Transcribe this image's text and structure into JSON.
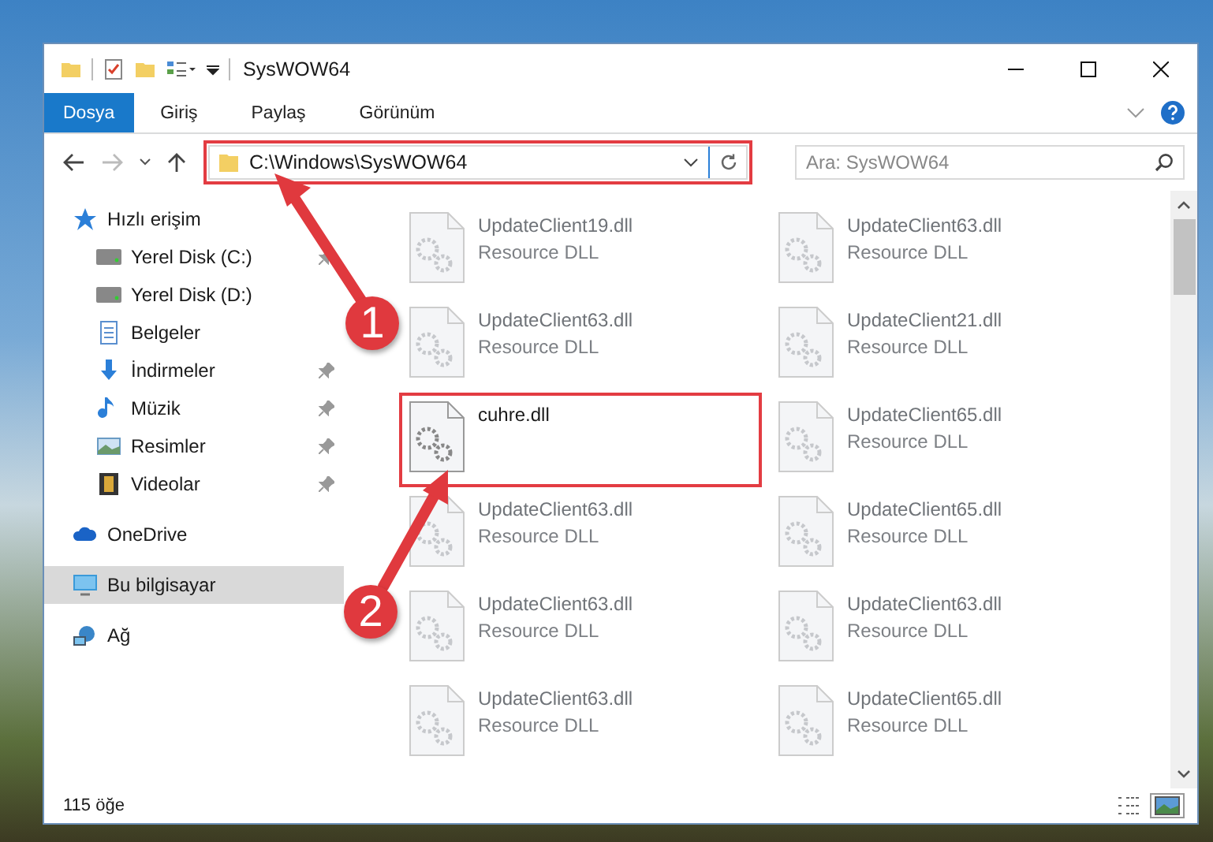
{
  "window": {
    "title": "SysWOW64"
  },
  "ribbon_tabs": [
    {
      "label": "Dosya",
      "kind": "file"
    },
    {
      "label": "Giriş",
      "kind": "tab"
    },
    {
      "label": "Paylaş",
      "kind": "tab"
    },
    {
      "label": "Görünüm",
      "kind": "tab"
    }
  ],
  "address_bar": {
    "path": "C:\\Windows\\SysWOW64",
    "highlighted": true
  },
  "search": {
    "placeholder": "Ara: SysWOW64"
  },
  "navigation": [
    {
      "label": "Hızlı erişim",
      "kind": "star",
      "selected": false,
      "children": [
        {
          "label": "Yerel Disk (C:)",
          "kind": "drive",
          "pinned": true,
          "selected": false
        },
        {
          "label": "Yerel Disk (D:)",
          "kind": "drive",
          "pinned": false,
          "selected": false
        },
        {
          "label": "Belgeler",
          "kind": "docs",
          "pinned": false,
          "selected": false
        },
        {
          "label": "İndirmeler",
          "kind": "download",
          "pinned": true,
          "selected": false
        },
        {
          "label": "Müzik",
          "kind": "music",
          "pinned": true,
          "selected": false
        },
        {
          "label": "Resimler",
          "kind": "pictures",
          "pinned": true,
          "selected": false
        },
        {
          "label": "Videolar",
          "kind": "video",
          "pinned": true,
          "selected": false
        }
      ]
    },
    {
      "label": "OneDrive",
      "kind": "cloud",
      "selected": false
    },
    {
      "label": "Bu bilgisayar",
      "kind": "pc",
      "selected": true
    },
    {
      "label": "Ağ",
      "kind": "network",
      "selected": false
    }
  ],
  "files": [
    {
      "name": "UpdateClient19.dll",
      "type": "Resource DLL",
      "blurred": true,
      "highlighted": false
    },
    {
      "name": "UpdateClient63.dll",
      "type": "Resource DLL",
      "blurred": true,
      "highlighted": false
    },
    {
      "name": "UpdateClient63.dll",
      "type": "Resource DLL",
      "blurred": true,
      "highlighted": false
    },
    {
      "name": "UpdateClient21.dll",
      "type": "Resource DLL",
      "blurred": true,
      "highlighted": false
    },
    {
      "name": "cuhre.dll",
      "blurred": false,
      "highlighted": true
    },
    {
      "name": "UpdateClient65.dll",
      "type": "Resource DLL",
      "blurred": true,
      "highlighted": false
    },
    {
      "name": "UpdateClient63.dll",
      "type": "Resource DLL",
      "blurred": true,
      "highlighted": false
    },
    {
      "name": "UpdateClient65.dll",
      "type": "Resource DLL",
      "blurred": true,
      "highlighted": false
    },
    {
      "name": "UpdateClient63.dll",
      "type": "Resource DLL",
      "blurred": true,
      "highlighted": false
    },
    {
      "name": "UpdateClient63.dll",
      "type": "Resource DLL",
      "blurred": true,
      "highlighted": false
    },
    {
      "name": "UpdateClient63.dll",
      "type": "Resource DLL",
      "blurred": true,
      "highlighted": false
    },
    {
      "name": "UpdateClient65.dll",
      "type": "Resource DLL",
      "blurred": true,
      "highlighted": false
    }
  ],
  "status_bar": {
    "item_count": "115 öğe",
    "view_modes": [
      {
        "kind": "details",
        "selected": false
      },
      {
        "kind": "large-icons",
        "selected": true
      }
    ]
  },
  "annotations": [
    {
      "number": "1"
    },
    {
      "number": "2"
    }
  ]
}
